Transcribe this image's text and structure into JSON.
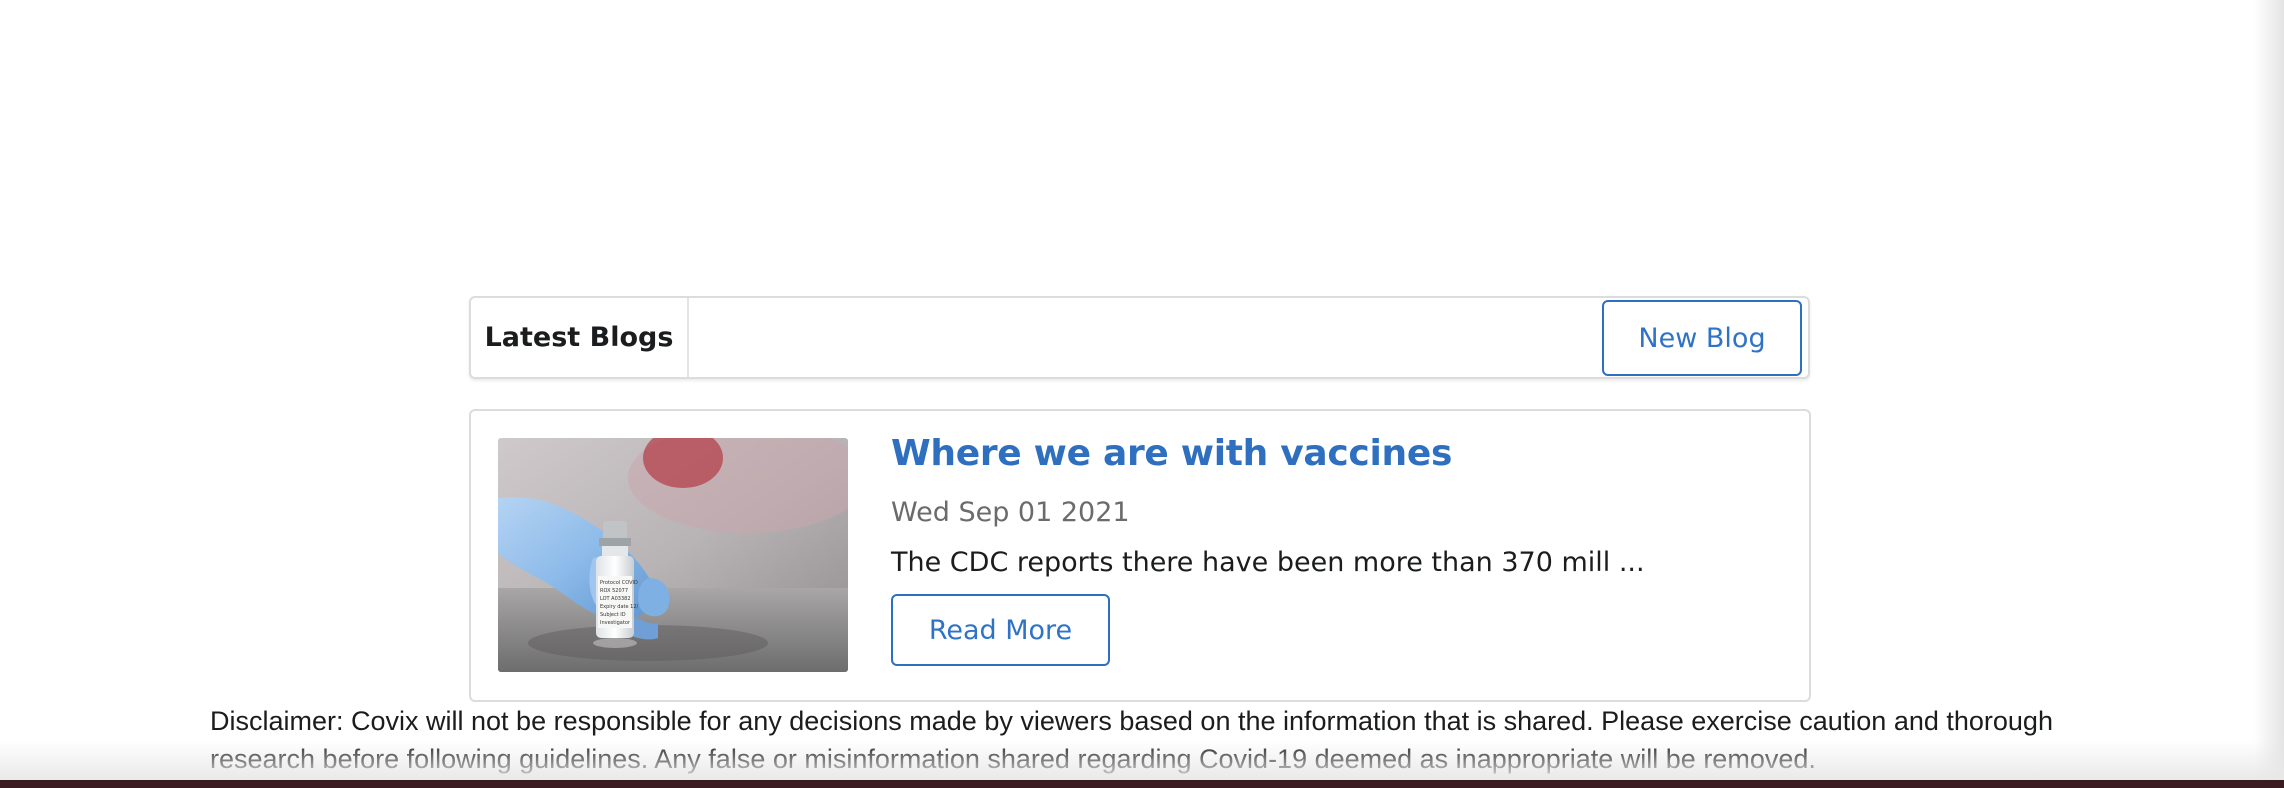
{
  "blog_menu": {
    "title": "Latest Blogs",
    "new_blog_label": "New Blog"
  },
  "blog_posts": [
    {
      "title": "Where we are with vaccines",
      "date": "Wed Sep 01 2021",
      "excerpt": "The CDC reports there have been more than 370 mill ...",
      "read_more_label": "Read More",
      "image": {
        "icon": "vaccine-vial-photo",
        "vial_label_lines": [
          "Protocol COVID",
          "ROX 52077",
          "LOT A03382",
          "Expiry date  12/",
          "Subject ID",
          "Investigator"
        ]
      }
    }
  ],
  "footer": {
    "disclaimer": "Disclaimer: Covix will not be responsible for any decisions made by viewers based on the information that is shared. Please exercise caution and thorough research before following guidelines. Any false or misinformation shared regarding Covid-19 deemed as inappropriate will be removed."
  },
  "colors": {
    "accent": "#2f6fbf",
    "text": "#1b1c1d",
    "muted": "#6b6b6b",
    "border": "#dcdcdc"
  }
}
